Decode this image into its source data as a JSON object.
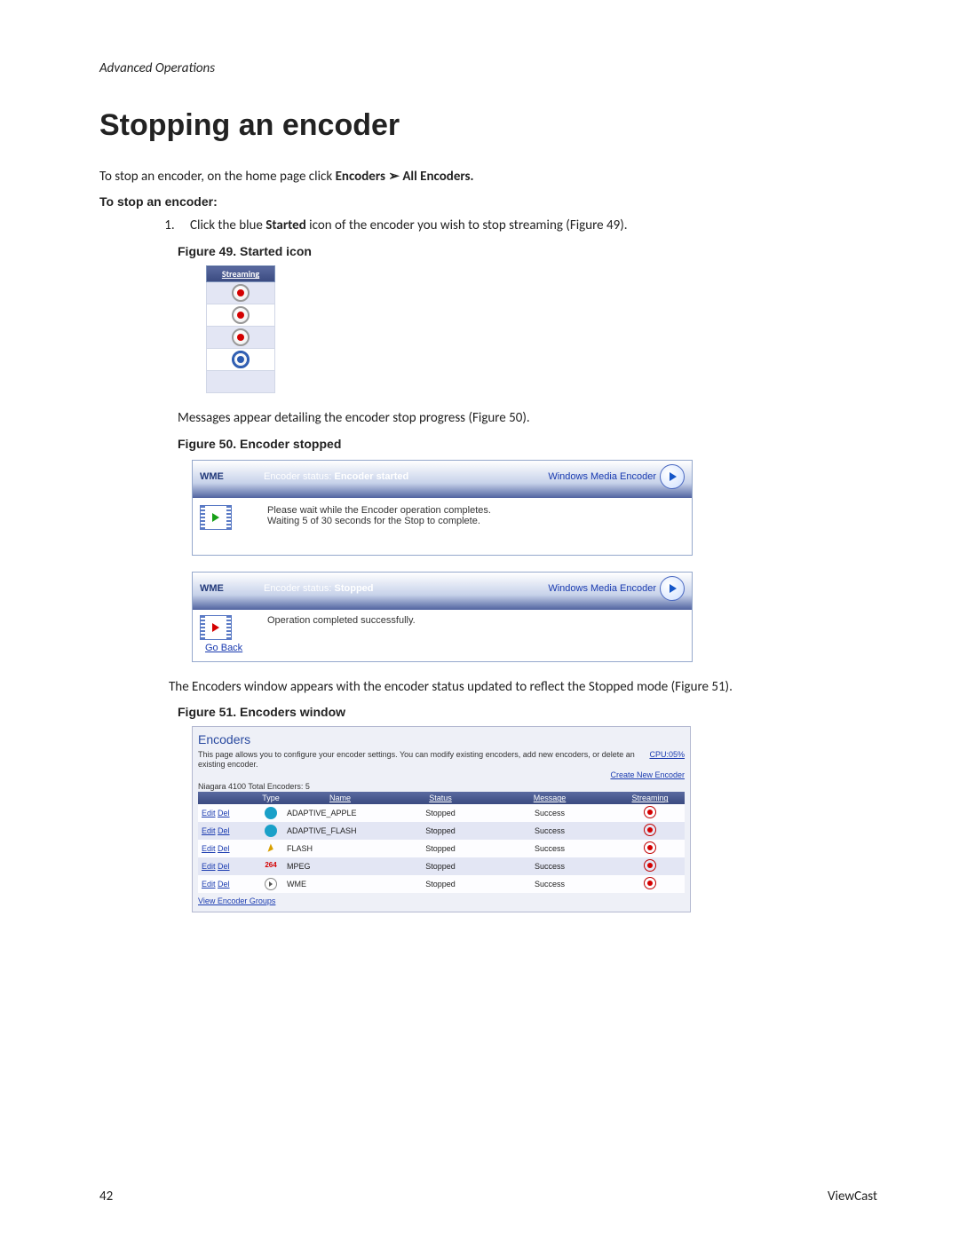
{
  "page": {
    "section": "Advanced Operations",
    "title": "Stopping an encoder",
    "intro_prefix": "To stop an encoder, on the home page click ",
    "intro_bold1": "Encoders",
    "intro_arrow": " ➢ ",
    "intro_bold2": "All Encoders.",
    "subhead": "To stop an encoder:",
    "step1_prefix": "Click the blue ",
    "step1_bold": "Started",
    "step1_suffix": " icon of the encoder you wish to stop streaming (Figure 49).",
    "fig49_caption": "Figure 49. Started icon",
    "fig49_header": "Streaming",
    "mid_text": "Messages appear detailing the encoder stop progress (Figure 50).",
    "fig50_caption": "Figure 50. Encoder stopped",
    "panel1": {
      "name": "WME",
      "status_label": "Encoder status: ",
      "status_value": "Encoder started",
      "right": "Windows Media Encoder",
      "line1": "Please wait while the Encoder operation completes.",
      "line2": "Waiting 5 of 30 seconds for the Stop to complete."
    },
    "panel2": {
      "name": "WME",
      "status_label": "Encoder status: ",
      "status_value": "Stopped",
      "right": "Windows Media Encoder",
      "line1": "Operation completed successfully.",
      "go_back": "Go Back"
    },
    "after_panels": "The Encoders window appears with the encoder status updated to reflect the Stopped mode (Figure 51).",
    "fig51_caption": "Figure 51. Encoders window",
    "fig51": {
      "title": "Encoders",
      "desc": "This page allows you to configure your encoder settings. You can modify existing encoders, add new encoders, or delete an existing encoder.",
      "cpu": "CPU:05%",
      "cne": "Create New Encoder",
      "total": "Niagara 4100 Total Encoders: 5",
      "cols": {
        "type": "Type",
        "name": "Name",
        "status": "Status",
        "message": "Message",
        "streaming": "Streaming"
      },
      "edit": "Edit",
      "del": "Del",
      "rows": [
        {
          "name": "ADAPTIVE_APPLE",
          "status": "Stopped",
          "message": "Success",
          "type": "apple"
        },
        {
          "name": "ADAPTIVE_FLASH",
          "status": "Stopped",
          "message": "Success",
          "type": "apple"
        },
        {
          "name": "FLASH",
          "status": "Stopped",
          "message": "Success",
          "type": "flash"
        },
        {
          "name": "MPEG",
          "status": "Stopped",
          "message": "Success",
          "type": "mpeg"
        },
        {
          "name": "WME",
          "status": "Stopped",
          "message": "Success",
          "type": "wme"
        }
      ],
      "veg": "View Encoder Groups"
    },
    "footer_left": "42",
    "footer_right": "ViewCast"
  }
}
